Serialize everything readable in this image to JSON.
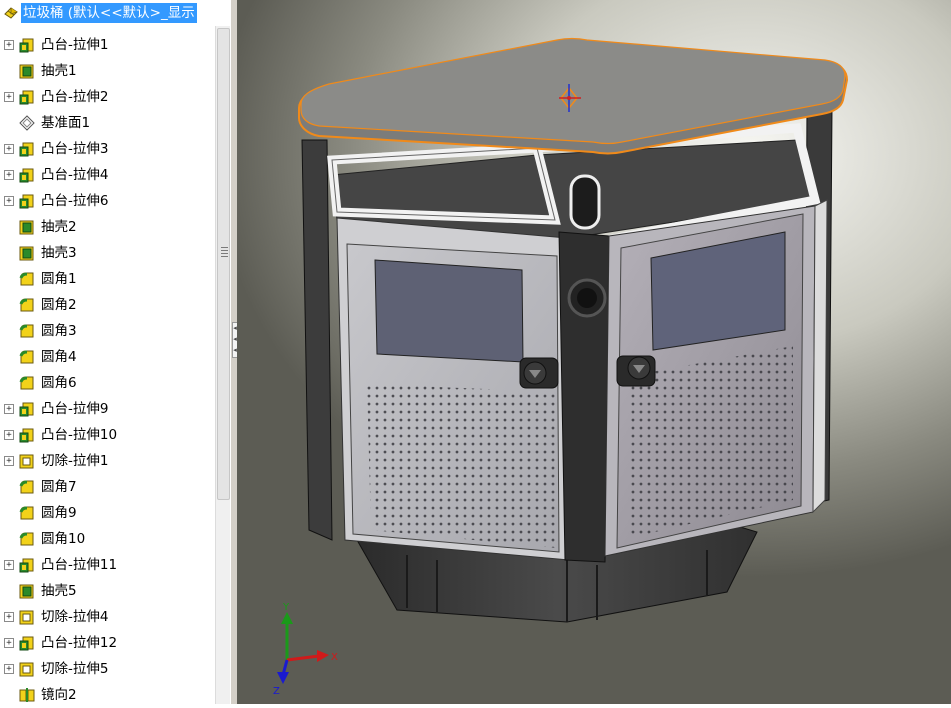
{
  "feature_tree": {
    "root_label": "垃圾桶 (默认<<默认>_显示",
    "items": [
      {
        "label": "凸台-拉伸1",
        "icon": "boss-extrude-icon",
        "expandable": true
      },
      {
        "label": "抽壳1",
        "icon": "shell-icon",
        "expandable": false
      },
      {
        "label": "凸台-拉伸2",
        "icon": "boss-extrude-icon",
        "expandable": true
      },
      {
        "label": "基准面1",
        "icon": "plane-icon",
        "expandable": false
      },
      {
        "label": "凸台-拉伸3",
        "icon": "boss-extrude-icon",
        "expandable": true
      },
      {
        "label": "凸台-拉伸4",
        "icon": "boss-extrude-icon",
        "expandable": true
      },
      {
        "label": "凸台-拉伸6",
        "icon": "boss-extrude-icon",
        "expandable": true
      },
      {
        "label": "抽壳2",
        "icon": "shell-icon",
        "expandable": false
      },
      {
        "label": "抽壳3",
        "icon": "shell-icon",
        "expandable": false
      },
      {
        "label": "圆角1",
        "icon": "fillet-icon",
        "expandable": false
      },
      {
        "label": "圆角2",
        "icon": "fillet-icon",
        "expandable": false
      },
      {
        "label": "圆角3",
        "icon": "fillet-icon",
        "expandable": false
      },
      {
        "label": "圆角4",
        "icon": "fillet-icon",
        "expandable": false
      },
      {
        "label": "圆角6",
        "icon": "fillet-icon",
        "expandable": false
      },
      {
        "label": "凸台-拉伸9",
        "icon": "boss-extrude-icon",
        "expandable": true
      },
      {
        "label": "凸台-拉伸10",
        "icon": "boss-extrude-icon",
        "expandable": true
      },
      {
        "label": "切除-拉伸1",
        "icon": "cut-extrude-icon",
        "expandable": true
      },
      {
        "label": "圆角7",
        "icon": "fillet-icon",
        "expandable": false
      },
      {
        "label": "圆角9",
        "icon": "fillet-icon",
        "expandable": false
      },
      {
        "label": "圆角10",
        "icon": "fillet-icon",
        "expandable": false
      },
      {
        "label": "凸台-拉伸11",
        "icon": "boss-extrude-icon",
        "expandable": true
      },
      {
        "label": "抽壳5",
        "icon": "shell-icon",
        "expandable": false
      },
      {
        "label": "切除-拉伸4",
        "icon": "cut-extrude-icon",
        "expandable": true
      },
      {
        "label": "凸台-拉伸12",
        "icon": "boss-extrude-icon",
        "expandable": true
      },
      {
        "label": "切除-拉伸5",
        "icon": "cut-extrude-icon",
        "expandable": true
      },
      {
        "label": "镜向2",
        "icon": "mirror-icon",
        "expandable": false
      }
    ]
  },
  "triad": {
    "x_label": "X",
    "y_label": "Y",
    "z_label": "Z"
  },
  "colors": {
    "selection": "#3399ff",
    "highlight_edge": "#f08a1a",
    "feature_yellow": "#f2d21a",
    "feature_green": "#2a8a2a"
  }
}
